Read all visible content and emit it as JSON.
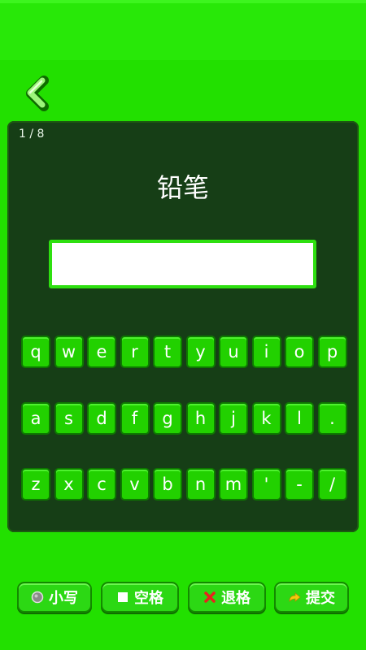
{
  "header": {
    "back_icon": "chevron-left-icon"
  },
  "quiz": {
    "progress": "1 / 8",
    "word": "铅笔",
    "answer": ""
  },
  "keyboard": {
    "rows": [
      [
        "q",
        "w",
        "e",
        "r",
        "t",
        "y",
        "u",
        "i",
        "o",
        "p"
      ],
      [
        "a",
        "s",
        "d",
        "f",
        "g",
        "h",
        "j",
        "k",
        "l",
        "."
      ],
      [
        "z",
        "x",
        "c",
        "v",
        "b",
        "n",
        "m",
        "'",
        "-",
        "/"
      ]
    ]
  },
  "actions": {
    "lowercase_label": "小写",
    "space_label": "空格",
    "backspace_label": "退格",
    "submit_label": "提交"
  },
  "colors": {
    "background": "#22e000",
    "board": "#163e16",
    "key": "#22d100"
  }
}
